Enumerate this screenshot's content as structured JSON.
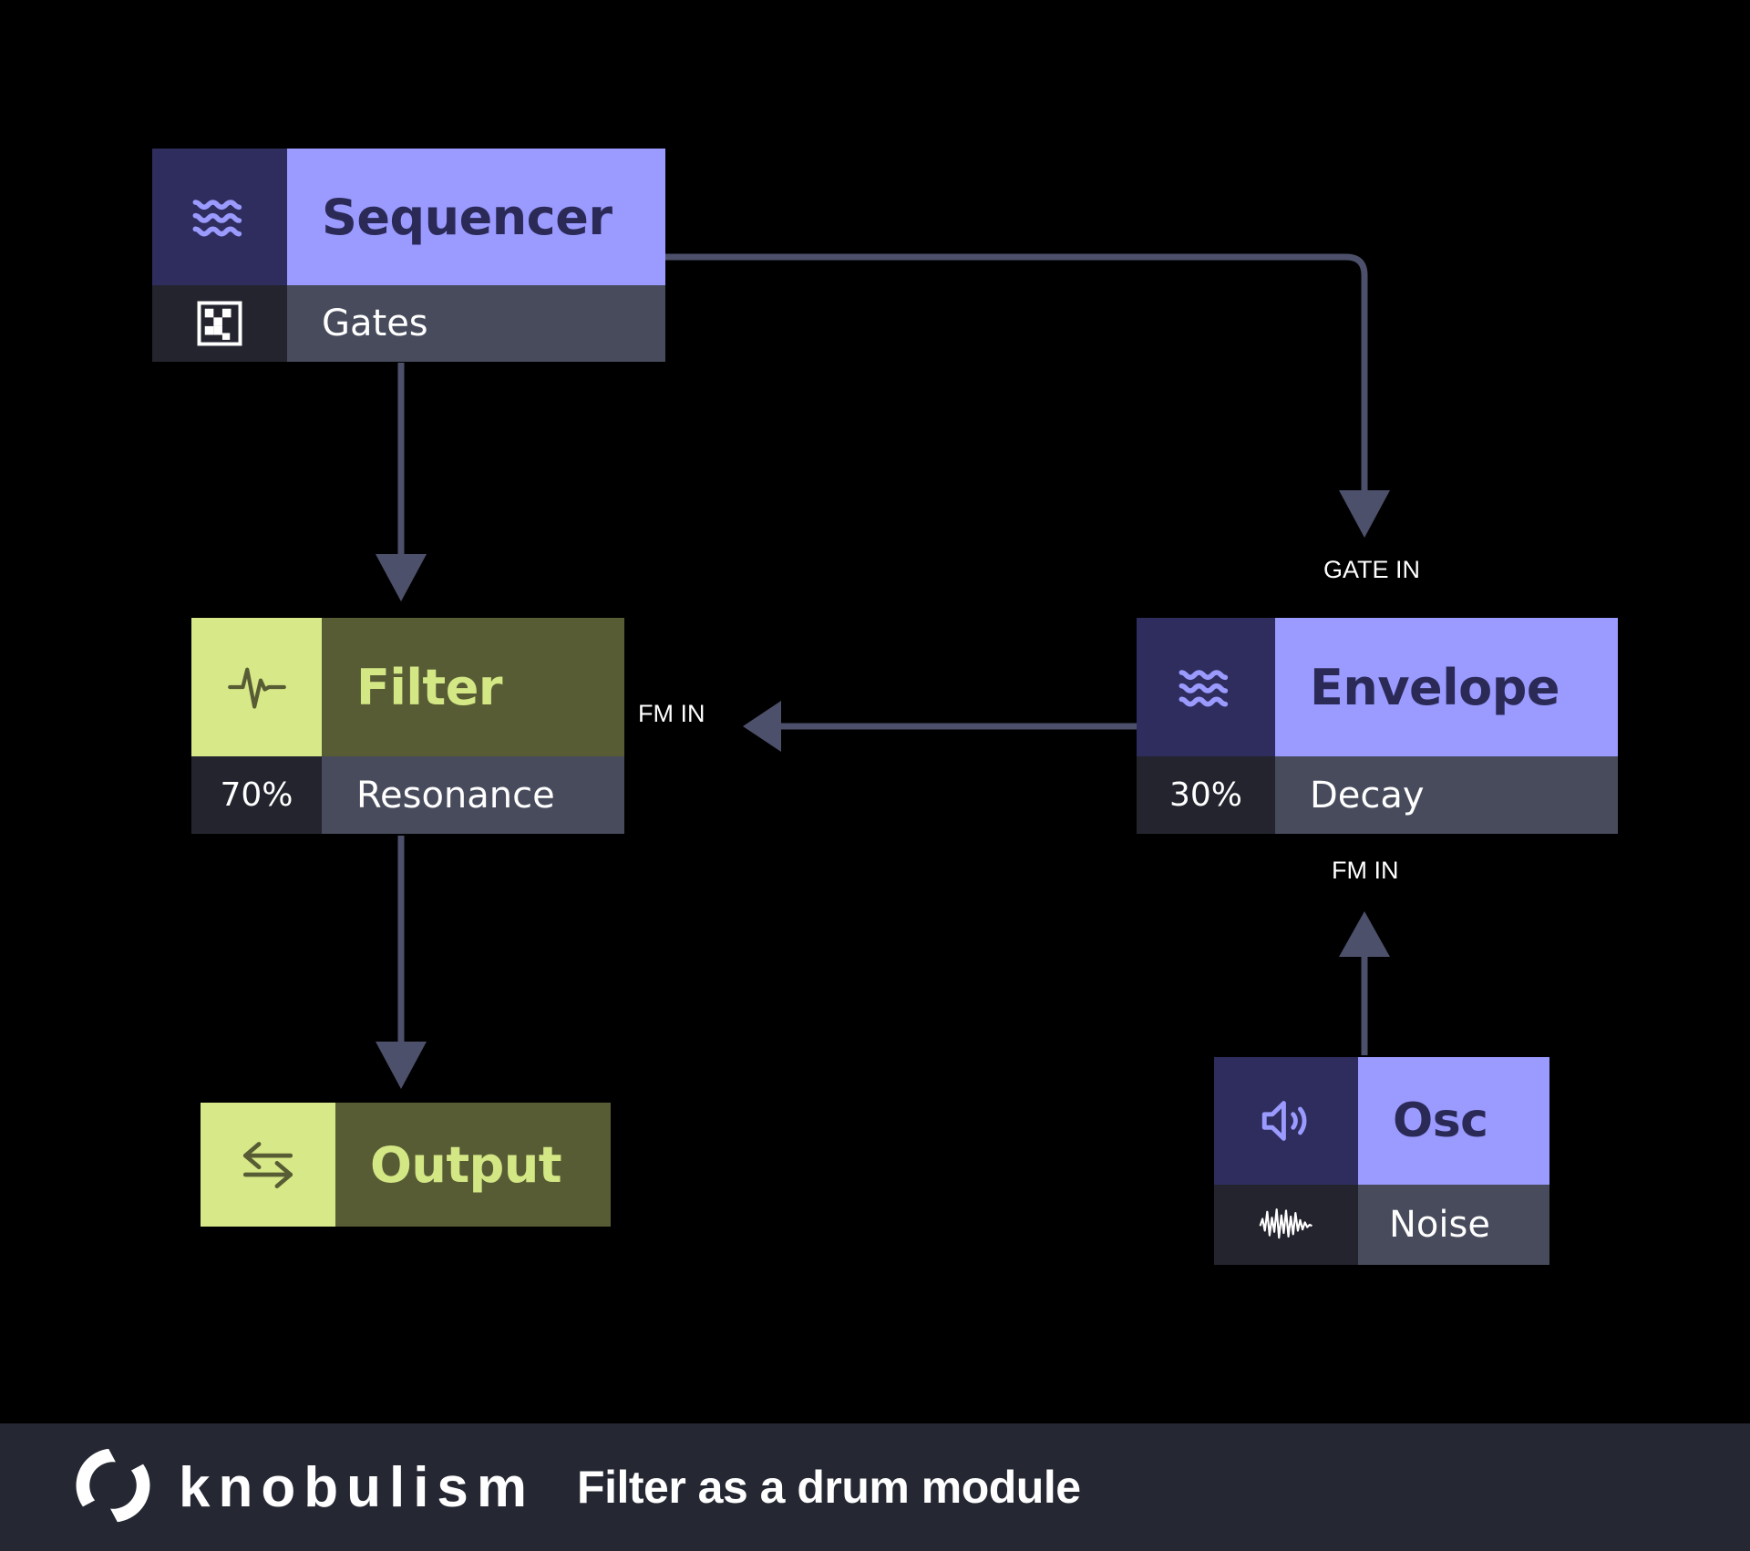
{
  "canvas": {
    "background": "#000000"
  },
  "theme": {
    "purple_accent": "#9a9aff",
    "purple_icon_bg": "#2e2d5e",
    "purple_title_text": "#2b2a57",
    "olive_accent": "#d6e887",
    "olive_title_bg": "#585c35",
    "olive_title_text": "#d3e784",
    "sub_value_bg": "#24242f",
    "sub_label_bg": "#474b5c",
    "wire_color": "#4d506b",
    "footer_bg": "#252833"
  },
  "modules": {
    "sequencer": {
      "title": "Sequencer",
      "icon": "waves-icon",
      "sub_icon": "grid-checker-icon",
      "sub_label": "Gates",
      "theme": "purple"
    },
    "filter": {
      "title": "Filter",
      "icon": "pulse-waveform-icon",
      "sub_value": "70%",
      "sub_label": "Resonance",
      "theme": "olive"
    },
    "envelope": {
      "title": "Envelope",
      "icon": "waves-icon",
      "sub_value": "30%",
      "sub_label": "Decay",
      "theme": "purple"
    },
    "osc": {
      "title": "Osc",
      "icon": "speaker-icon",
      "sub_icon": "noise-waveform-icon",
      "sub_label": "Noise",
      "theme": "purple"
    },
    "output": {
      "title": "Output",
      "icon": "arrows-exchange-icon",
      "theme": "olive"
    }
  },
  "ports": {
    "gate_in": "GATE IN",
    "fm_in_filter": "FM IN",
    "fm_in_envelope": "FM IN"
  },
  "footer": {
    "brand": "knobulism",
    "logo": "knobulism-logo-icon",
    "title": "Filter as a drum module"
  }
}
